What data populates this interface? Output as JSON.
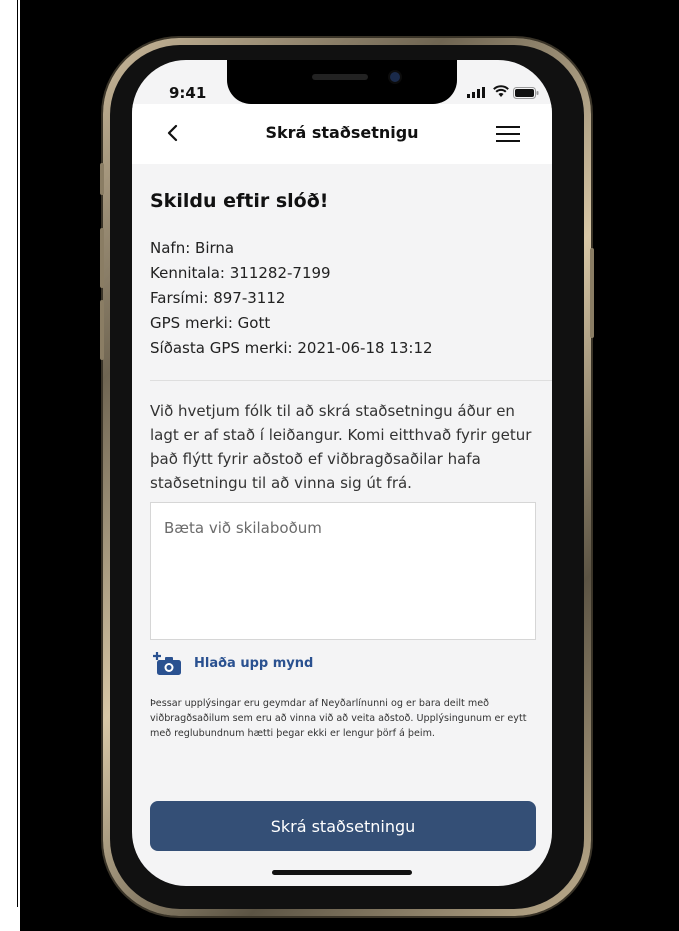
{
  "status_bar": {
    "time": "9:41"
  },
  "navbar": {
    "title": "Skrá staðsetnigu"
  },
  "main": {
    "heading": "Skildu eftir slóð!",
    "info": [
      "Nafn: Birna",
      "Kennitala: 311282-7199",
      "Farsími: 897-3112",
      "GPS merki: Gott",
      "Síðasta GPS merki: 2021-06-18 13:12"
    ],
    "paragraph": "Við hvetjum fólk til að skrá staðsetningu áður en lagt er af stað í leiðangur. Komi eitthvað fyrir getur það flýtt fyrir aðstoð ef viðbragðsaðilar hafa staðsetningu til að vinna sig út frá.",
    "message_placeholder": "Bæta við skilaboðum",
    "upload_label": "Hlaða upp mynd",
    "disclaimer": "Þessar upplýsingar eru geymdar af Neyðarlínunni og er bara deilt með viðbragðsaðilum sem eru að vinna við að veita aðstoð. Upplýsingunum er eytt með reglubundnum hætti þegar ekki er lengur þörf á þeim.",
    "submit_label": "Skrá staðsetningu"
  },
  "colors": {
    "primary_button": "#344f76",
    "link": "#2a5190",
    "background": "#f4f4f5"
  },
  "icons": [
    "back-chevron-icon",
    "hamburger-menu-icon",
    "camera-plus-icon",
    "cellular-signal-icon",
    "wifi-icon",
    "battery-icon"
  ]
}
